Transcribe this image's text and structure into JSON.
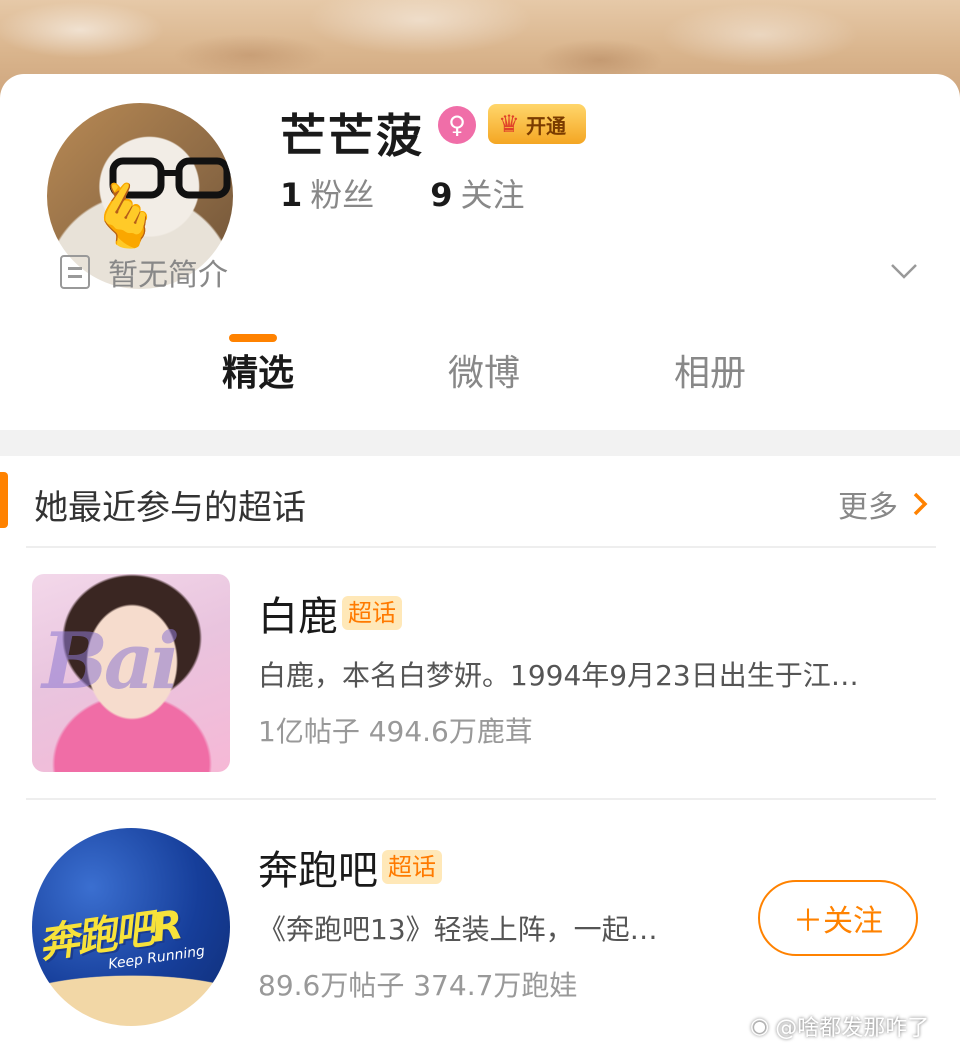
{
  "profile": {
    "username": "芒芒菠",
    "gender_icon": "female-icon",
    "vip_label": "开通",
    "followers_count": "1",
    "followers_label": "粉丝",
    "following_count": "9",
    "following_label": "关注",
    "bio": "暂无简介"
  },
  "tabs": [
    {
      "label": "精选",
      "active": true
    },
    {
      "label": "微博",
      "active": false
    },
    {
      "label": "相册",
      "active": false
    }
  ],
  "section": {
    "title": "她最近参与的超话",
    "more_label": "更多"
  },
  "topics": [
    {
      "name": "白鹿",
      "tag": "超话",
      "description": "白鹿，本名白梦妍。1994年9月23日出生于江…",
      "stats": "1亿帖子 494.6万鹿茸",
      "thumb_text": "Bai"
    },
    {
      "name": "奔跑吧",
      "tag": "超话",
      "description": "《奔跑吧13》轻装上阵，一起…",
      "stats": "89.6万帖子 374.7万跑娃",
      "thumb_text": "奔跑吧R",
      "thumb_sub": "Keep Running",
      "follow_label": "＋关注"
    }
  ],
  "credit": "@啥都发那咋了",
  "colors": {
    "accent": "#ff8200",
    "super_tag_bg": "#ffe8b8",
    "gender_pink": "#f06ea8"
  }
}
